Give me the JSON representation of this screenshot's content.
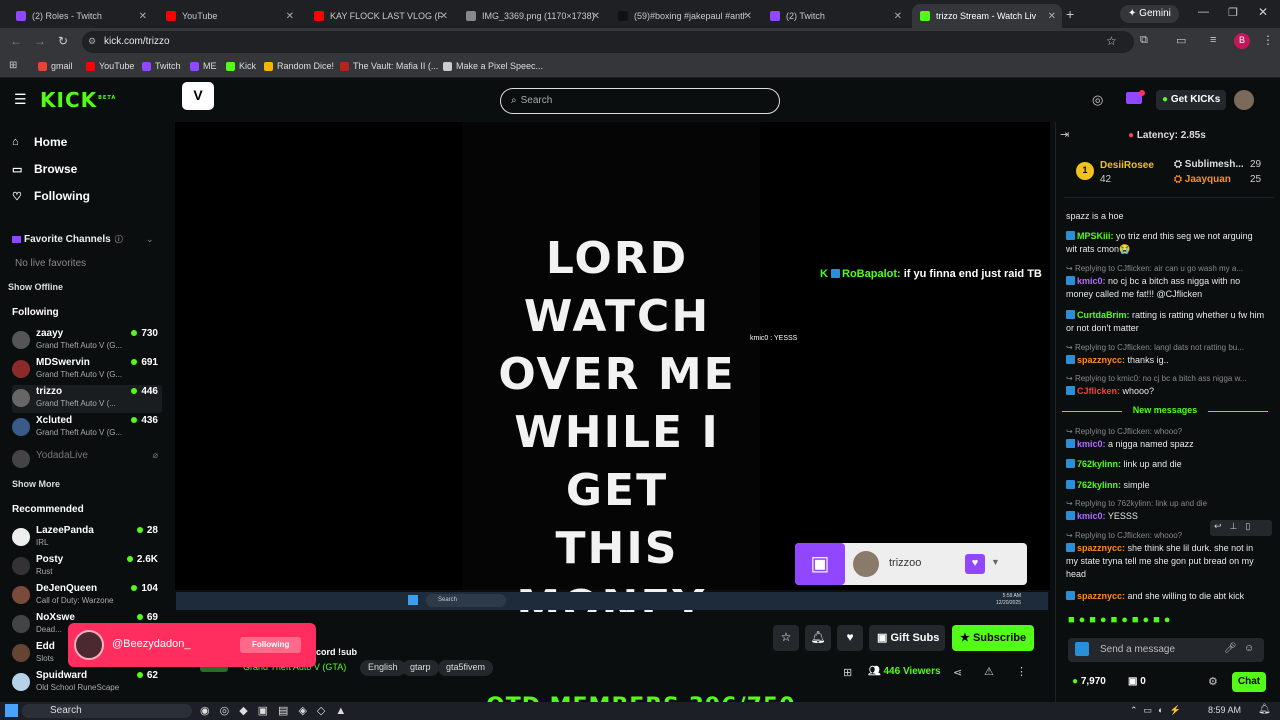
{
  "browser": {
    "tabs": [
      {
        "label": "(2) Roles - Twitch",
        "color": "#9146ff"
      },
      {
        "label": "YouTube",
        "color": "#ff0000"
      },
      {
        "label": "KAY FLOCK LAST VLOG (Ft. D",
        "color": "#ff0000"
      },
      {
        "label": "IMG_3369.png (1170×1738)",
        "color": "#888888"
      },
      {
        "label": "(59)#boxing #jakepaul #anth",
        "color": "#111111"
      },
      {
        "label": "(2) Twitch",
        "color": "#9146ff"
      },
      {
        "label": "trizzo Stream - Watch Liv",
        "color": "#53fc18"
      }
    ],
    "gemini": "Gemini",
    "url": "kick.com/trizzo",
    "profile_initial": "B",
    "bookmarks": [
      {
        "label": "gmail",
        "color": "#ea4335"
      },
      {
        "label": "YouTube",
        "color": "#ff0000"
      },
      {
        "label": "Twitch",
        "color": "#9146ff"
      },
      {
        "label": "ME",
        "color": "#9146ff"
      },
      {
        "label": "Kick",
        "color": "#53fc18"
      },
      {
        "label": "Random Dice!",
        "color": "#f7b500"
      },
      {
        "label": "The Vault: Mafia II (...",
        "color": "#b3261e"
      },
      {
        "label": "Make a Pixel Speec...",
        "color": "#cccccc"
      }
    ]
  },
  "header": {
    "logo": "KICK",
    "logo_tag": "BETA",
    "search_placeholder": "Search",
    "get_kicks": "Get KICKs"
  },
  "sidebar": {
    "nav": [
      "Home",
      "Browse",
      "Following"
    ],
    "favorite_title": "Favorite Channels",
    "no_favorites": "No live favorites",
    "show_offline": "Show Offline",
    "following_title": "Following",
    "following": [
      {
        "name": "zaayy",
        "game": "Grand Theft Auto V (G...",
        "viewers": "730"
      },
      {
        "name": "MDSwervin",
        "game": "Grand Theft Auto V (G...",
        "viewers": "691"
      },
      {
        "name": "trizzo",
        "game": "Grand Theft Auto V (...",
        "viewers": "446"
      },
      {
        "name": "Xcluted",
        "game": "Grand Theft Auto V (G...",
        "viewers": "436"
      }
    ],
    "offline_channel": "YodadaLive",
    "show_more": "Show More",
    "recommended_title": "Recommended",
    "recommended": [
      {
        "name": "LazeePanda",
        "game": "IRL",
        "viewers": "28"
      },
      {
        "name": "Posty",
        "game": "Rust",
        "viewers": "2.6K"
      },
      {
        "name": "DeJenQueen",
        "game": "Call of Duty: Warzone",
        "viewers": "104"
      },
      {
        "name": "NoXswe",
        "game": "Dead...",
        "viewers": "69"
      },
      {
        "name": "Edd",
        "game": "Slots",
        "viewers": ""
      },
      {
        "name": "Spuidward",
        "game": "Old School RuneScape",
        "viewers": "62"
      }
    ]
  },
  "video": {
    "quote_lines": [
      "LORD WATCH",
      "OVER ME",
      "WHILE I GET",
      "THIS MONEY."
    ],
    "overlay_user": "RoBapalot:",
    "overlay_text": "if yu finna end just raid TB",
    "overlay_small": "kmic0 : YESSS",
    "twitch_name": "trizzoo",
    "taskbar_search": "Search",
    "taskbar_time": "5:59 AM",
    "taskbar_date": "12/20/2025"
  },
  "stream": {
    "toast_user": "@Beezydadon_",
    "toast_status": "Following",
    "partial_title": "cord !sub",
    "category": "Grand Theft Auto V (GTA)",
    "tags": [
      "English",
      "gtarp",
      "gta5fivem"
    ],
    "gift_subs": "Gift Subs",
    "subscribe": "Subscribe",
    "viewers": "446 Viewers",
    "banner": "OTD MEMBERS 396/750"
  },
  "chat": {
    "latency": "Latency: 2.85s",
    "leaders": [
      {
        "name": "DesiiRosee",
        "count": "42"
      },
      {
        "name": "Sublimesh...",
        "count": "29"
      },
      {
        "name": "Jaayquan",
        "count": "25"
      }
    ],
    "messages": [
      {
        "type": "msg",
        "user": "",
        "color": "#ffffff",
        "text": "spazz is a hoe"
      },
      {
        "type": "msg",
        "user": "MPSKiii:",
        "color": "#53fc18",
        "text": "yo triz end this seg we not arguing wit rats cmon😭"
      },
      {
        "type": "reply",
        "text": "Replying to CJflicken: air can u go wash my a..."
      },
      {
        "type": "msg",
        "user": "kmic0:",
        "color": "#b36bff",
        "text": "no cj bc a bitch ass nigga with no money called me fat!!! @CJflicken"
      },
      {
        "type": "msg",
        "user": "CurtdaBrim:",
        "color": "#53fc18",
        "text": "ratting is ratting whether u fw him or not don't matter"
      },
      {
        "type": "reply",
        "text": "Replying to CJflicken: langl dats not ratting bu..."
      },
      {
        "type": "msg",
        "user": "spazznycc:",
        "color": "#ff8c1a",
        "text": "thanks ig.."
      },
      {
        "type": "reply",
        "text": "Replying to kmic0: no cj bc a bitch ass nigga w..."
      },
      {
        "type": "msg",
        "user": "CJflicken:",
        "color": "#ff3b3b",
        "text": "whooo?"
      }
    ],
    "new_messages": "New messages",
    "new": [
      {
        "type": "reply",
        "text": "Replying to CJflicken: whooo?"
      },
      {
        "type": "msg",
        "user": "kmic0:",
        "color": "#b36bff",
        "text": "a nigga named spazz"
      },
      {
        "type": "msg",
        "user": "762kylinn:",
        "color": "#53fc18",
        "text": "link up and die"
      },
      {
        "type": "msg",
        "user": "762kylinn:",
        "color": "#53fc18",
        "text": "simple"
      },
      {
        "type": "reply",
        "text": "Replying to 762kylinn: link up and die"
      },
      {
        "type": "msg",
        "user": "kmic0:",
        "color": "#b36bff",
        "text": "YESSS"
      },
      {
        "type": "reply",
        "text": "Replying to CJflicken: whooo?"
      },
      {
        "type": "msg",
        "user": "spazznycc:",
        "color": "#ff8c1a",
        "text": "she think she lil durk. she not in my state tryna tell me she gon put bread on my head"
      },
      {
        "type": "msg",
        "user": "spazznycc:",
        "color": "#ff8c1a",
        "text": "and she willing to die abt kick"
      }
    ],
    "input_placeholder": "Send a message",
    "kicks_balance": "7,970",
    "points": "0",
    "chat_button": "Chat"
  },
  "os": {
    "search": "Search",
    "time": "8:59 AM"
  }
}
